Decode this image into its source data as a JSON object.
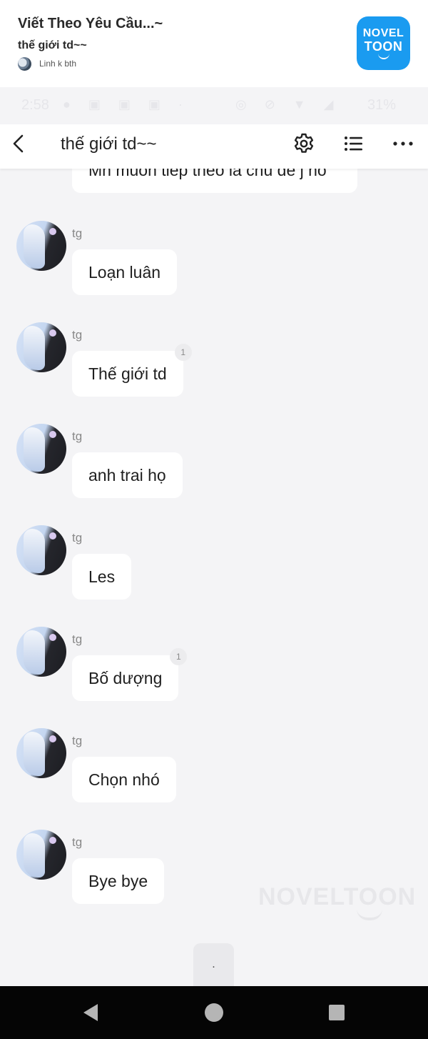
{
  "story_header": {
    "title": "Viết Theo Yêu Cầu...~",
    "subtitle": "thế giới td~~",
    "author": "Linh k bth",
    "logo_line1": "NOVEL",
    "logo_line2": "TOON"
  },
  "status_bar": {
    "time": "2:58",
    "battery": "31%"
  },
  "toolbar": {
    "title": "thế giới td~~",
    "icons": [
      "back-icon",
      "gear-icon",
      "list-icon",
      "more-icon"
    ]
  },
  "messages": {
    "partial_text": "Mn muốn tiếp theo là chủ đề j nò",
    "items": [
      {
        "sender": "tg",
        "text": "Loạn luân",
        "reactions": null
      },
      {
        "sender": "tg",
        "text": "Thế giới td",
        "reactions": "1"
      },
      {
        "sender": "tg",
        "text": "anh trai họ",
        "reactions": null
      },
      {
        "sender": "tg",
        "text": "Les",
        "reactions": null
      },
      {
        "sender": "tg",
        "text": "Bố dượng",
        "reactions": "1"
      },
      {
        "sender": "tg",
        "text": "Chọn nhó",
        "reactions": null
      },
      {
        "sender": "tg",
        "text": "Bye bye",
        "reactions": null
      }
    ]
  },
  "watermark": "NOVELTOON",
  "scroll_hint": ".",
  "colors": {
    "page_bg": "#f4f4f6",
    "bubble_bg": "#ffffff",
    "logo_blue": "#1a9bf0",
    "nav_bg": "#050505"
  }
}
